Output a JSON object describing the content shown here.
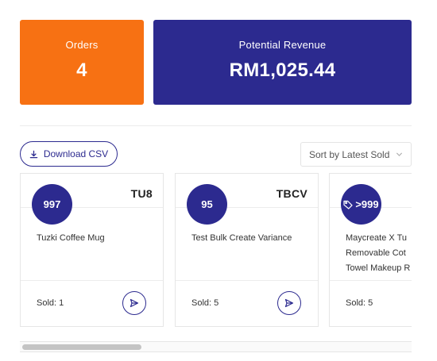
{
  "stats": {
    "orders": {
      "label": "Orders",
      "value": "4"
    },
    "revenue": {
      "label": "Potential Revenue",
      "value": "RM1,025.44"
    }
  },
  "toolbar": {
    "download_label": "Download CSV",
    "download_icon": "download-icon",
    "sort_label": "Sort by Latest Sold",
    "sort_icon": "chevron-down-icon"
  },
  "products": [
    {
      "qty": "997",
      "sku": "TU8",
      "name_lines": [
        "Tuzki Coffee Mug"
      ],
      "sold": "Sold: 1"
    },
    {
      "qty": "95",
      "sku": "TBCV",
      "name_lines": [
        "Test Bulk Create Variance"
      ],
      "sold": "Sold: 5"
    },
    {
      "qty": ">999",
      "qty_icon": "tag-icon",
      "sku": "",
      "name_lines": [
        "Maycreate X Tu",
        "Removable Cot",
        "Towel Makeup R"
      ],
      "sold": "Sold: 5"
    }
  ],
  "colors": {
    "orange": "#f77113",
    "indigo": "#2c2a8f"
  }
}
